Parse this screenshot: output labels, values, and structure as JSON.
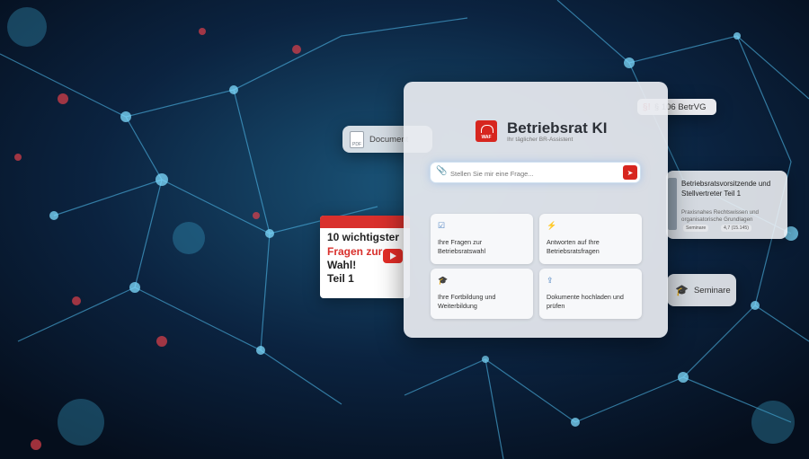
{
  "app": {
    "title": "Betriebsrat KI",
    "subtitle": "Ihr täglicher BR-Assistent",
    "logo_text": "WAF",
    "accent_color": "#d7261f"
  },
  "search": {
    "placeholder": "Stellen Sie mir eine Frage...",
    "attach_icon": "paperclip-icon",
    "send_icon": "send-icon"
  },
  "quick_actions": [
    {
      "icon": "checkbox-icon",
      "label": "Ihre Fragen zur Betriebsratswahl"
    },
    {
      "icon": "lightning-icon",
      "label": "Antworten auf Ihre Betriebsratsfragen"
    },
    {
      "icon": "graduation-cap-icon",
      "label": "Ihre Fortbildung und Weiterbildung"
    },
    {
      "icon": "upload-icon",
      "label": "Dokumente hochladen und prüfen"
    }
  ],
  "floating": {
    "document_chip": "Document",
    "law_chip": {
      "symbol": "§!",
      "label": "§ 106 BetrVG"
    },
    "video_thumb": {
      "line1": "10 wichtigster",
      "line2": "Fragen zur",
      "line3": "Wahl!",
      "line4": "Teil 1"
    },
    "seminar_card": {
      "title": "Betriebsratsvorsitzende und Stellvertreter Teil 1",
      "description": "Praxisnahes Rechtswissen und organisatorische Grundlagen",
      "tag": "Seminare",
      "rating": "4,7 (15.145)"
    },
    "seminare_button": "Seminare"
  }
}
